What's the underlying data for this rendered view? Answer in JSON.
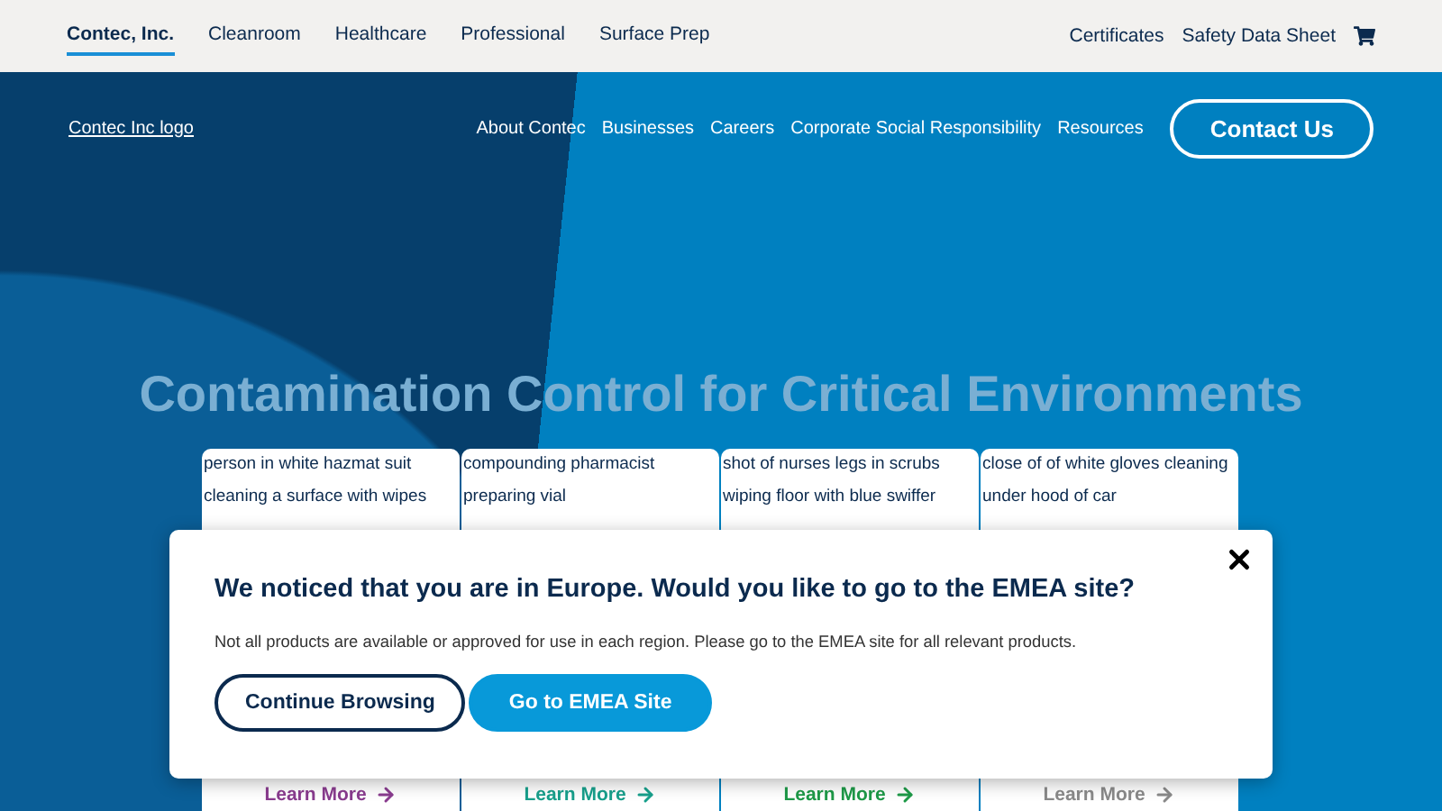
{
  "top_nav": {
    "items": [
      {
        "label": "Contec, Inc.",
        "selected": true
      },
      {
        "label": "Cleanroom",
        "selected": false
      },
      {
        "label": "Healthcare",
        "selected": false
      },
      {
        "label": "Professional",
        "selected": false
      },
      {
        "label": "Surface Prep",
        "selected": false
      }
    ],
    "right_links": [
      "Certificates",
      "Safety Data Sheet"
    ]
  },
  "header": {
    "logo_alt": "Contec Inc logo",
    "links": [
      "About Contec",
      "Businesses",
      "Careers",
      "Corporate Social Responsibility",
      "Resources"
    ],
    "cta": "Contact Us"
  },
  "hero": {
    "title": "Contamination Control for Critical Environments"
  },
  "cards": [
    {
      "image_alt": "person in white hazmat suit cleaning a surface with wipes",
      "link": "Learn More",
      "color": "#8a3c8f"
    },
    {
      "image_alt": "compounding pharmacist preparing vial",
      "link": "Learn More",
      "color": "#18a08c"
    },
    {
      "image_alt": "shot of nurses legs in scrubs wiping floor with blue swiffer",
      "link": "Learn More",
      "color": "#1e9a48"
    },
    {
      "image_alt": "close of of white gloves cleaning under hood of car",
      "link": "Learn More",
      "color": "#8a8a8a"
    }
  ],
  "modal": {
    "title": "We noticed that you are in Europe. Would you like to go to the EMEA site?",
    "text": "Not all products are available or approved for use in each region. Please go to the EMEA site for all relevant products.",
    "buttons": [
      {
        "label": "Continue Browsing",
        "kind": "outline"
      },
      {
        "label": "Go to EMEA Site",
        "kind": "primary"
      }
    ]
  }
}
